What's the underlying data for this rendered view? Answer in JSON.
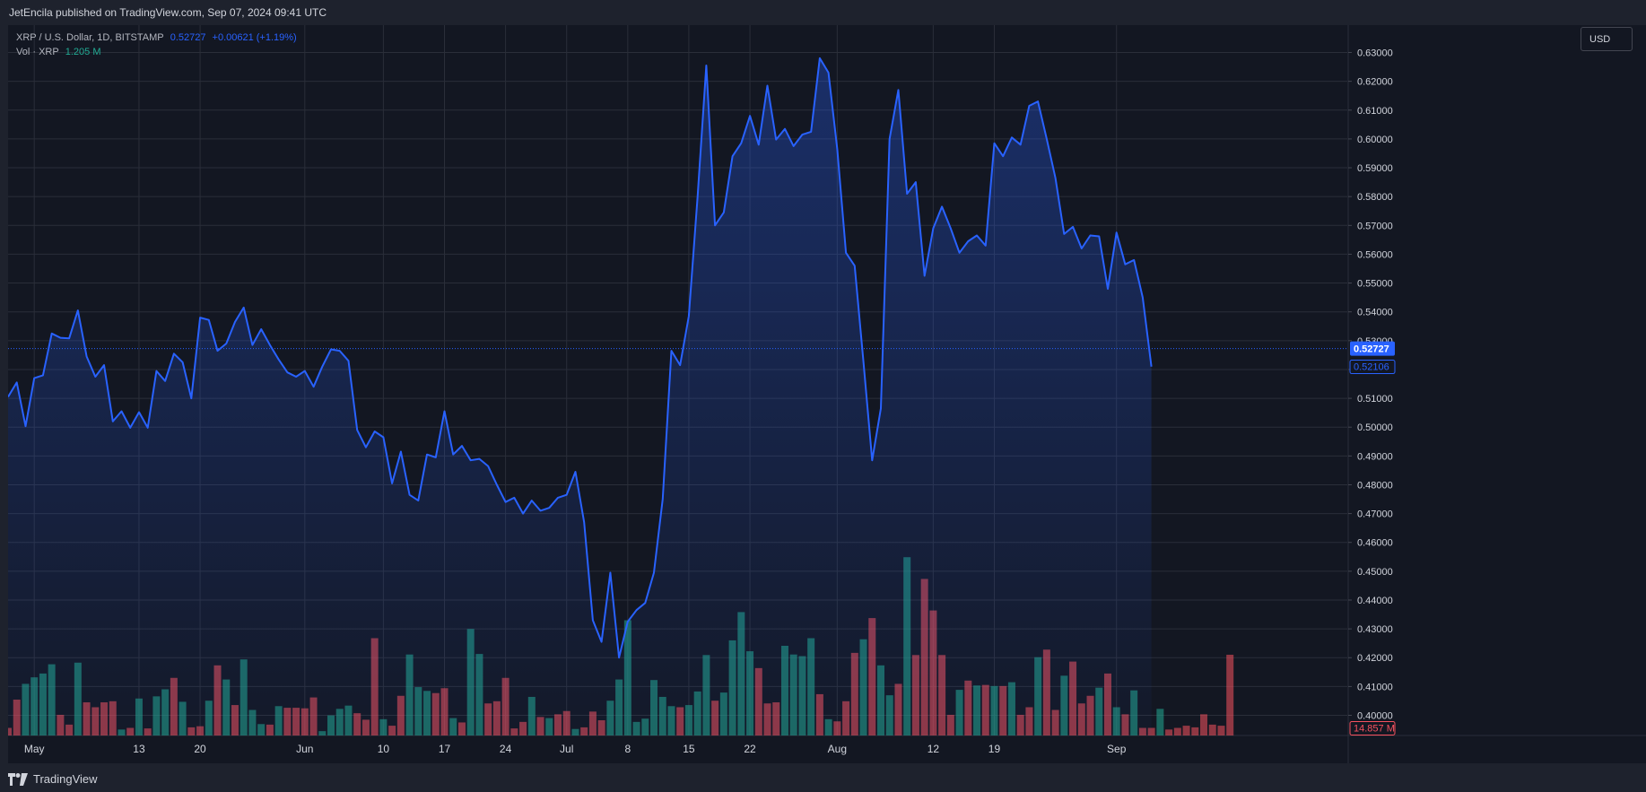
{
  "header": {
    "published": "JetEncila published on TradingView.com, Sep 07, 2024 09:41 UTC"
  },
  "legend": {
    "symbol": "XRP / U.S. Dollar, 1D, BITSTAMP",
    "price": "0.52727",
    "change": "+0.00621 (+1.19%)",
    "volume_label": "Vol · XRP",
    "volume_value": "1.205 M"
  },
  "currency_button": "USD",
  "footer": {
    "brand": "TradingView"
  },
  "colors": {
    "background": "#131722",
    "line": "#2962ff",
    "volume_up": "#22ab94",
    "volume_down": "#f7525f",
    "grid": "#2a2e39",
    "price_label_bg": "#2962ff"
  },
  "chart_data": {
    "type": "area",
    "title": "XRP / U.S. Dollar, 1D, BITSTAMP",
    "ylim": [
      0.393,
      0.6395
    ],
    "y_ticks": [
      "0.63000",
      "0.62000",
      "0.61000",
      "0.60000",
      "0.59000",
      "0.58000",
      "0.57000",
      "0.56000",
      "0.55000",
      "0.54000",
      "0.53000",
      "0.52000",
      "0.51000",
      "0.50000",
      "0.49000",
      "0.48000",
      "0.47000",
      "0.46000",
      "0.45000",
      "0.44000",
      "0.43000",
      "0.42000",
      "0.41000",
      "0.40000"
    ],
    "x_ticks": [
      {
        "label": "May",
        "index": 3
      },
      {
        "label": "13",
        "index": 15
      },
      {
        "label": "20",
        "index": 22
      },
      {
        "label": "Jun",
        "index": 34
      },
      {
        "label": "10",
        "index": 43
      },
      {
        "label": "17",
        "index": 50
      },
      {
        "label": "24",
        "index": 57
      },
      {
        "label": "Jul",
        "index": 64
      },
      {
        "label": "8",
        "index": 71
      },
      {
        "label": "15",
        "index": 78
      },
      {
        "label": "22",
        "index": 85
      },
      {
        "label": "Aug",
        "index": 95
      },
      {
        "label": "12",
        "index": 106
      },
      {
        "label": "19",
        "index": 113
      },
      {
        "label": "Sep",
        "index": 127
      }
    ],
    "current_price": {
      "value": 0.52727,
      "label": "0.52727"
    },
    "last_close": {
      "value": 0.52106,
      "label": "0.52106"
    },
    "volume_label": {
      "label": "14.857 M"
    },
    "series": [
      {
        "name": "XRP",
        "values": [
          0.5105,
          0.5155,
          0.5003,
          0.517,
          0.518,
          0.5325,
          0.531,
          0.5308,
          0.5405,
          0.5245,
          0.5175,
          0.5215,
          0.502,
          0.5055,
          0.4998,
          0.5052,
          0.4998,
          0.5195,
          0.516,
          0.5255,
          0.5225,
          0.51,
          0.538,
          0.5372,
          0.5265,
          0.529,
          0.5365,
          0.5415,
          0.5285,
          0.534,
          0.5285,
          0.5235,
          0.519,
          0.5175,
          0.5195,
          0.514,
          0.521,
          0.527,
          0.5265,
          0.523,
          0.499,
          0.493,
          0.4985,
          0.4965,
          0.4805,
          0.4915,
          0.4765,
          0.4745,
          0.4905,
          0.4895,
          0.5055,
          0.4905,
          0.4935,
          0.4885,
          0.489,
          0.4865,
          0.48,
          0.474,
          0.4755,
          0.47,
          0.4745,
          0.471,
          0.472,
          0.4755,
          0.4765,
          0.4845,
          0.467,
          0.433,
          0.4255,
          0.4495,
          0.42,
          0.4325,
          0.4365,
          0.439,
          0.4495,
          0.475,
          0.5265,
          0.5215,
          0.5385,
          0.58,
          0.6255,
          0.57,
          0.5745,
          0.594,
          0.5985,
          0.608,
          0.598,
          0.6185,
          0.5998,
          0.6035,
          0.5975,
          0.6015,
          0.6025,
          0.628,
          0.623,
          0.5965,
          0.5605,
          0.556,
          0.523,
          0.4885,
          0.5065,
          0.6,
          0.617,
          0.581,
          0.585,
          0.5525,
          0.569,
          0.5765,
          0.569,
          0.5605,
          0.5645,
          0.5665,
          0.563,
          0.5985,
          0.594,
          0.6005,
          0.598,
          0.6115,
          0.613,
          0.6,
          0.5865,
          0.567,
          0.5695,
          0.562,
          0.5665,
          0.5662,
          0.548,
          0.5675,
          0.5565,
          0.558,
          0.545,
          0.521
        ]
      },
      {
        "name": "Vol · XRP",
        "values": [
          1.4,
          6.6,
          9.5,
          10.7,
          11.4,
          13.1,
          3.8,
          2.0,
          13.4,
          6.1,
          5.2,
          6.1,
          6.3,
          1.1,
          1.4,
          6.8,
          1.3,
          7.2,
          8.5,
          10.6,
          6.2,
          1.5,
          1.7,
          6.4,
          12.9,
          10.3,
          5.6,
          14.0,
          4.7,
          2.1,
          2.0,
          5.4,
          5.1,
          5.1,
          5.0,
          7.0,
          0.8,
          3.7,
          4.9,
          5.5,
          4.1,
          2.9,
          17.9,
          3.0,
          1.8,
          7.3,
          14.9,
          8.9,
          8.2,
          7.8,
          8.7,
          3.2,
          2.4,
          19.6,
          15.0,
          5.9,
          6.3,
          10.6,
          1.3,
          2.5,
          7.1,
          3.4,
          3.2,
          3.9,
          4.5,
          1.2,
          1.5,
          4.4,
          2.8,
          6.4,
          10.3,
          21.2,
          2.5,
          3.1,
          10.2,
          7.1,
          5.4,
          5.2,
          5.6,
          8.1,
          14.8,
          6.4,
          7.9,
          17.5,
          22.7,
          15.5,
          12.4,
          5.9,
          6.1,
          16.5,
          14.9,
          14.6,
          17.9,
          7.6,
          3.0,
          2.6,
          6.3,
          15.2,
          17.7,
          21.6,
          12.9,
          7.4,
          9.5,
          32.8,
          14.8,
          28.8,
          23.0,
          14.8,
          3.8,
          8.4,
          10.1,
          9.2,
          9.3,
          9.1,
          9.1,
          9.8,
          3.8,
          5.2,
          14.4,
          15.8,
          4.7,
          11.0,
          13.6,
          5.9,
          7.3,
          8.8,
          11.4,
          5.2,
          3.9,
          8.3,
          1.4,
          1.4,
          4.9,
          1.1,
          1.4,
          1.8,
          1.5,
          3.9,
          2.0,
          1.8,
          14.857
        ],
        "directions": "DDUUUUDDUDDDDUDUDUUDUDDUDUDUUUDUDDDDUUUUDDDUDDUUUDDUDUUDDDDDUDUDDUDDDUUUUUUUUDUUUDUUUUDDDUUUUDUDDDUDUUDUDDDDDUDUDUDUDDUDDUDDDUDUDUDDUD"
      }
    ]
  }
}
